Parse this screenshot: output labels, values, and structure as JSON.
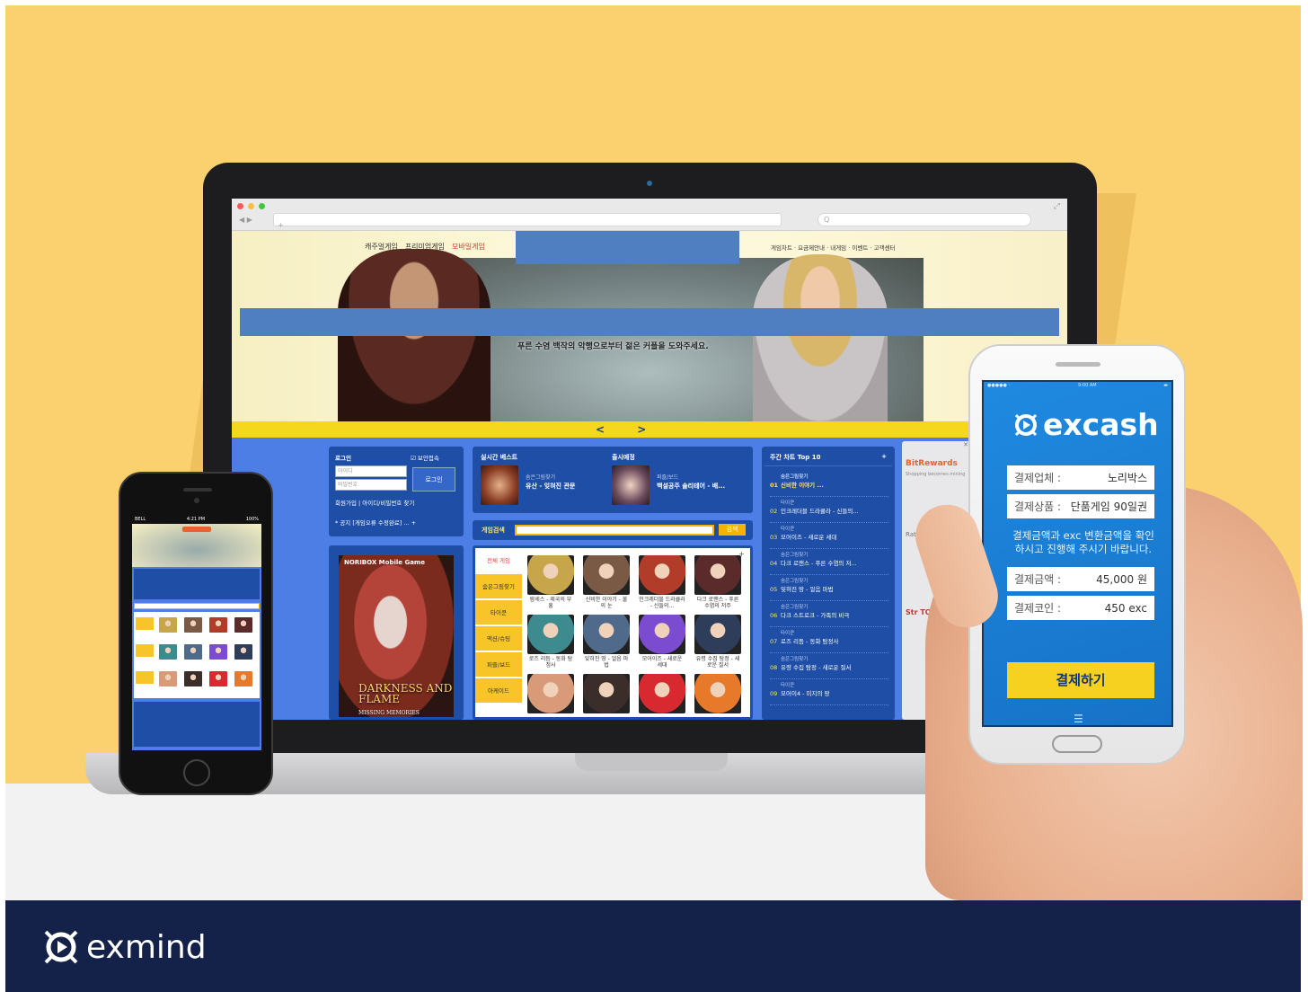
{
  "browser": {
    "search_placeholder": "Q"
  },
  "site": {
    "menu": [
      "캐주얼게임",
      "프리미엄게임",
      "모바일게임"
    ],
    "active_menu_index": 2,
    "util_menu": "게임차트 · 요금제안내 · 내게임 · 이벤트 · 고객센터",
    "hero_caption": "푸른 수염 백작의 악행으로부터 젊은 커플을 도와주세요.",
    "slider_arrows": "< >"
  },
  "login": {
    "title": "로그인",
    "security": "보안접속",
    "id_placeholder": "아이디",
    "pw_placeholder": "비밀번호",
    "button": "로그인",
    "links": "회원가입 | 아이디/비밀번호 찾기",
    "notice": "* 공지  [게임오류 수정완료] ...  +"
  },
  "realtime": {
    "title": "실시간 베스트",
    "game_genre": "숨은그림찾기",
    "game_name": "유산 - 잊혀진 관문"
  },
  "release": {
    "title": "출시예정",
    "game_genre": "퍼즐/보드",
    "game_name": "백설공주 솔리테어 - 배..."
  },
  "search": {
    "label": "게임검색",
    "button": "검색"
  },
  "promo": {
    "brand": "NORIBOX Mobile Game",
    "title": "DARKNESS AND FLAME",
    "subtitle": "MISSING MEMORIES"
  },
  "categories": [
    "전체 게임",
    "숨은그림찾기",
    "타이쿤",
    "액션/슈팅",
    "퍼즐/보드",
    "아케이드"
  ],
  "games": [
    {
      "caption": "람세스 - 제국의 부흥",
      "color": "#c7a54a"
    },
    {
      "caption": "신비한 이야기 - 불의 눈",
      "color": "#7a5a44"
    },
    {
      "caption": "인크레더블 드라큘라 - 신들의...",
      "color": "#b23c2a"
    },
    {
      "caption": "다크 로맨스 - 푸른 수염의 저주",
      "color": "#5b2a2a"
    },
    {
      "caption": "로즈 리듬 - 동화 탐정사",
      "color": "#3d8a8f"
    },
    {
      "caption": "잊혀진 땅 - 얼음 마법",
      "color": "#4f6a8a"
    },
    {
      "caption": "모어이즈 - 새로운 세대",
      "color": "#7b4bd0"
    },
    {
      "caption": "유령 수집 탐정 - 새로운 질서",
      "color": "#2e3e5a"
    },
    {
      "caption": "",
      "color": "#d99a79"
    },
    {
      "caption": "",
      "color": "#3b2d2a"
    },
    {
      "caption": "",
      "color": "#d7292f"
    },
    {
      "caption": "",
      "color": "#e67a2a"
    }
  ],
  "weekly": {
    "title": "주간 차트 Top 10",
    "items": [
      {
        "no": "01",
        "genre": "숨은그림찾기",
        "name": "신비한 이야기 ..."
      },
      {
        "no": "02",
        "genre": "타이쿤",
        "name": "인크레더블 드라큘라 - 신들의..."
      },
      {
        "no": "03",
        "genre": "타이쿤",
        "name": "모어이즈 - 새로운 세대"
      },
      {
        "no": "04",
        "genre": "숨은그림찾기",
        "name": "다크 로맨스 - 푸른 수염의 저..."
      },
      {
        "no": "05",
        "genre": "숨은그림찾기",
        "name": "잊혀진 땅 - 얼음 마법"
      },
      {
        "no": "06",
        "genre": "숨은그림찾기",
        "name": "다크 스트로크 - 가족의 비극"
      },
      {
        "no": "07",
        "genre": "타이쿤",
        "name": "로즈 리듬 - 동화 탐정사"
      },
      {
        "no": "08",
        "genre": "숨은그림찾기",
        "name": "유령 수집 탐정 - 새로운 질서"
      },
      {
        "no": "09",
        "genre": "타이쿤",
        "name": "모어이4 - 미지의 땅"
      }
    ]
  },
  "ad": {
    "brand": "BitRewards",
    "tagline": "Shopping becomes mining",
    "rating": "Rating Positive",
    "fragment": "Str TO THE"
  },
  "phone_small": {
    "carrier": "BELL",
    "time": "4:21 PM",
    "battery": "100%"
  },
  "excash": {
    "status_time": "9:00 AM",
    "logo": "excash",
    "merchant_key": "결제업체 :",
    "merchant_val": "노리박스",
    "product_key": "결제상품 :",
    "product_val": "단품게임 90일권",
    "note": "결제금액과 exc 변환금액을 확인하시고 진행해 주시기 바랍니다.",
    "amount_key": "결제금액 :",
    "amount_val": "45,000 원",
    "coin_key": "결제코인 :",
    "coin_val": "450  exc",
    "pay_button": "결제하기"
  },
  "footer": {
    "brand": "exmind"
  }
}
